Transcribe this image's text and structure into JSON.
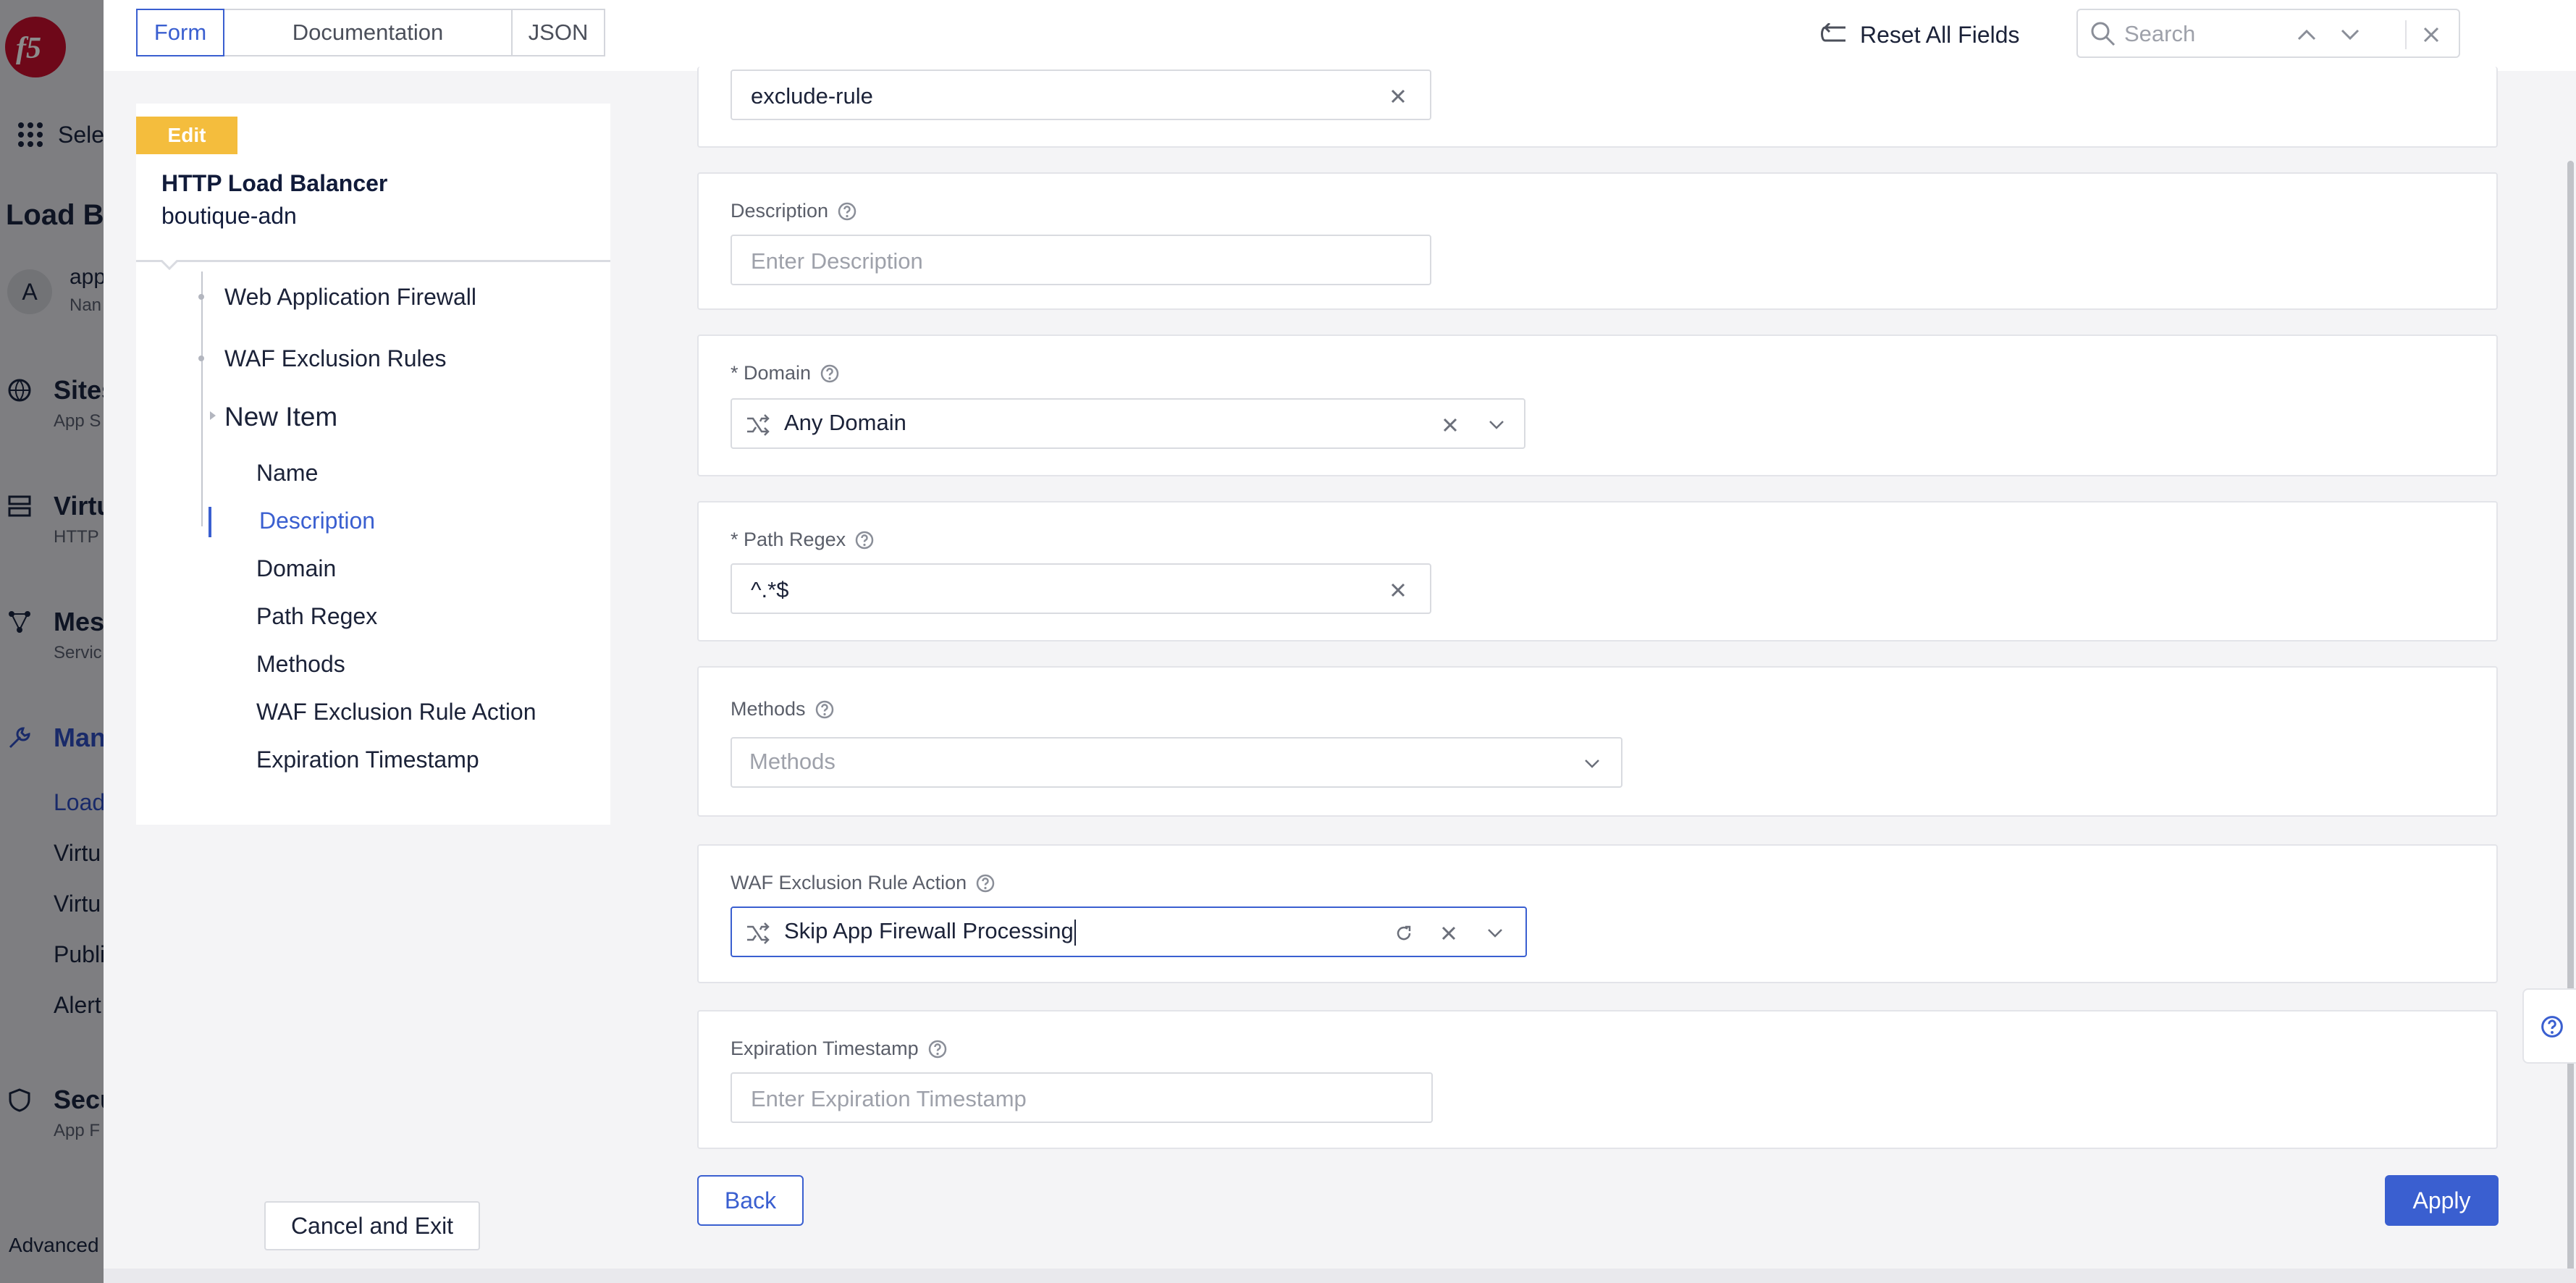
{
  "background_app": {
    "logo_text": "f5",
    "select_label": "Sele",
    "page_title": "Load Ba",
    "user": {
      "avatar_initial": "A",
      "name": "app",
      "sub": "Nan"
    },
    "nav": [
      {
        "label": "Sites",
        "sub": "App S",
        "icon": "globe-icon"
      },
      {
        "label": "Virtu",
        "sub": "HTTP",
        "icon": "server-icon"
      },
      {
        "label": "Mes",
        "sub": "Servic",
        "icon": "mesh-icon"
      },
      {
        "label": "Man",
        "sub": "",
        "icon": "wrench-icon"
      },
      {
        "label": "Load",
        "sub": ""
      },
      {
        "label": "Virtu",
        "sub": ""
      },
      {
        "label": "Virtu",
        "sub": ""
      },
      {
        "label": "Publi",
        "sub": ""
      },
      {
        "label": "Alert",
        "sub": ""
      },
      {
        "label": "Secu",
        "sub": "App F",
        "icon": "shield-icon"
      }
    ],
    "advanced_label": "Advanced"
  },
  "toolbar": {
    "tabs": [
      {
        "label": "Form",
        "active": true
      },
      {
        "label": "Documentation",
        "active": false
      },
      {
        "label": "JSON",
        "active": false
      }
    ],
    "reset_label": "Reset All Fields",
    "search_placeholder": "Search"
  },
  "sidebar_nav": {
    "badge": "Edit",
    "object_kind": "HTTP Load Balancer",
    "object_name": "boutique-adn",
    "tree": [
      "Web Application Firewall",
      "WAF Exclusion Rules",
      "New Item"
    ],
    "items": [
      "Name",
      "Description",
      "Domain",
      "Path Regex",
      "Methods",
      "WAF Exclusion Rule Action",
      "Expiration Timestamp"
    ],
    "active_item": "Description",
    "cancel_label": "Cancel and Exit"
  },
  "form": {
    "name": {
      "value": "exclude-rule"
    },
    "description": {
      "label": "Description",
      "placeholder": "Enter Description"
    },
    "domain": {
      "label": "* Domain",
      "value": "Any Domain"
    },
    "path_regex": {
      "label": "* Path Regex",
      "value": "^.*$"
    },
    "methods": {
      "label": "Methods",
      "placeholder": "Methods"
    },
    "waf_action": {
      "label": "WAF Exclusion Rule Action",
      "value": "Skip App Firewall Processing"
    },
    "expiration": {
      "label": "Expiration Timestamp",
      "placeholder": "Enter Expiration Timestamp"
    }
  },
  "footer": {
    "back_label": "Back",
    "apply_label": "Apply"
  },
  "colors": {
    "accent": "#3a5fd0",
    "badge": "#f4bd3d",
    "logo": "#c8102e"
  }
}
